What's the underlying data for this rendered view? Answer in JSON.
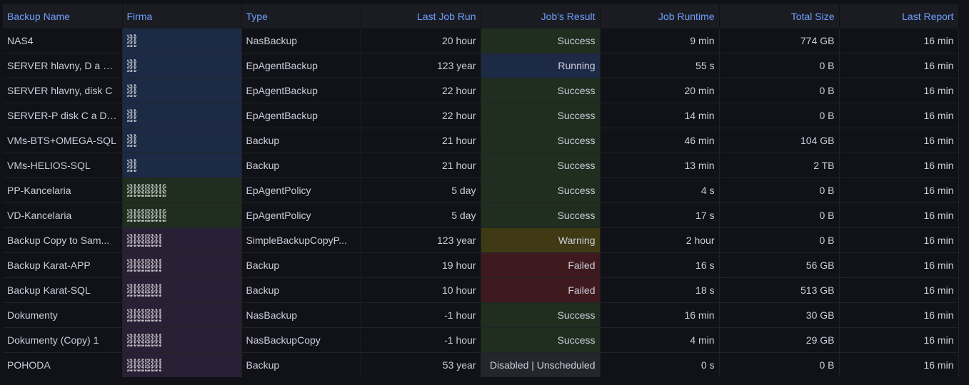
{
  "columns": [
    "Backup Name",
    "Firma",
    "Type",
    "Last Job Run",
    "Job's Result",
    "Job Runtime",
    "Total Size",
    "Last Report"
  ],
  "colors": {
    "firma_blue": "#1d2a45",
    "firma_green": "#1f2e1f",
    "firma_purple": "#2a2035",
    "result_success": "#1f2e1f",
    "result_running": "#1d2a45",
    "result_warning": "#3f3a14",
    "result_failed": "#3e1a1e",
    "result_disabled": "#25262b"
  },
  "rows": [
    {
      "name": "NAS4",
      "firma_group": "blue",
      "type": "NasBackup",
      "last_run": "20 hour",
      "result": "Success",
      "result_state": "success",
      "runtime": "9 min",
      "size": "774 GB",
      "report": "16 min"
    },
    {
      "name": "SERVER hlavny, D a E,...",
      "firma_group": "blue",
      "type": "EpAgentBackup",
      "last_run": "123 year",
      "result": "Running",
      "result_state": "running",
      "runtime": "55 s",
      "size": "0 B",
      "report": "16 min"
    },
    {
      "name": "SERVER hlavny, disk C",
      "firma_group": "blue",
      "type": "EpAgentBackup",
      "last_run": "22 hour",
      "result": "Success",
      "result_state": "success",
      "runtime": "20 min",
      "size": "0 B",
      "report": "16 min"
    },
    {
      "name": "SERVER-P disk C a D,...",
      "firma_group": "blue",
      "type": "EpAgentBackup",
      "last_run": "22 hour",
      "result": "Success",
      "result_state": "success",
      "runtime": "14 min",
      "size": "0 B",
      "report": "16 min"
    },
    {
      "name": "VMs-BTS+OMEGA-SQL",
      "firma_group": "blue",
      "type": "Backup",
      "last_run": "21 hour",
      "result": "Success",
      "result_state": "success",
      "runtime": "46 min",
      "size": "104 GB",
      "report": "16 min"
    },
    {
      "name": "VMs-HELIOS-SQL",
      "firma_group": "blue",
      "type": "Backup",
      "last_run": "21 hour",
      "result": "Success",
      "result_state": "success",
      "runtime": "13 min",
      "size": "2 TB",
      "report": "16 min"
    },
    {
      "name": "PP-Kancelaria",
      "firma_group": "green",
      "type": "EpAgentPolicy",
      "last_run": "5 day",
      "result": "Success",
      "result_state": "success",
      "runtime": "4 s",
      "size": "0 B",
      "report": "16 min"
    },
    {
      "name": "VD-Kancelaria",
      "firma_group": "green",
      "type": "EpAgentPolicy",
      "last_run": "5 day",
      "result": "Success",
      "result_state": "success",
      "runtime": "17 s",
      "size": "0 B",
      "report": "16 min"
    },
    {
      "name": "Backup Copy to Sam...",
      "firma_group": "purple",
      "type": "SimpleBackupCopyP...",
      "last_run": "123 year",
      "result": "Warning",
      "result_state": "warning",
      "runtime": "2 hour",
      "size": "0 B",
      "report": "16 min"
    },
    {
      "name": "Backup Karat-APP",
      "firma_group": "purple",
      "type": "Backup",
      "last_run": "19 hour",
      "result": "Failed",
      "result_state": "failed",
      "runtime": "16 s",
      "size": "56 GB",
      "report": "16 min"
    },
    {
      "name": "Backup Karat-SQL",
      "firma_group": "purple",
      "type": "Backup",
      "last_run": "10 hour",
      "result": "Failed",
      "result_state": "failed",
      "runtime": "18 s",
      "size": "513 GB",
      "report": "16 min"
    },
    {
      "name": "Dokumenty",
      "firma_group": "purple",
      "type": "NasBackup",
      "last_run": "-1 hour",
      "result": "Success",
      "result_state": "success",
      "runtime": "16 min",
      "size": "30 GB",
      "report": "16 min"
    },
    {
      "name": "Dokumenty (Copy) 1",
      "firma_group": "purple",
      "type": "NasBackupCopy",
      "last_run": "-1 hour",
      "result": "Success",
      "result_state": "success",
      "runtime": "4 min",
      "size": "29 GB",
      "report": "16 min"
    },
    {
      "name": "POHODA",
      "firma_group": "purple",
      "type": "Backup",
      "last_run": "53 year",
      "result": "Disabled | Unscheduled",
      "result_state": "disabled",
      "runtime": "0 s",
      "size": "0 B",
      "report": "16 min"
    }
  ]
}
